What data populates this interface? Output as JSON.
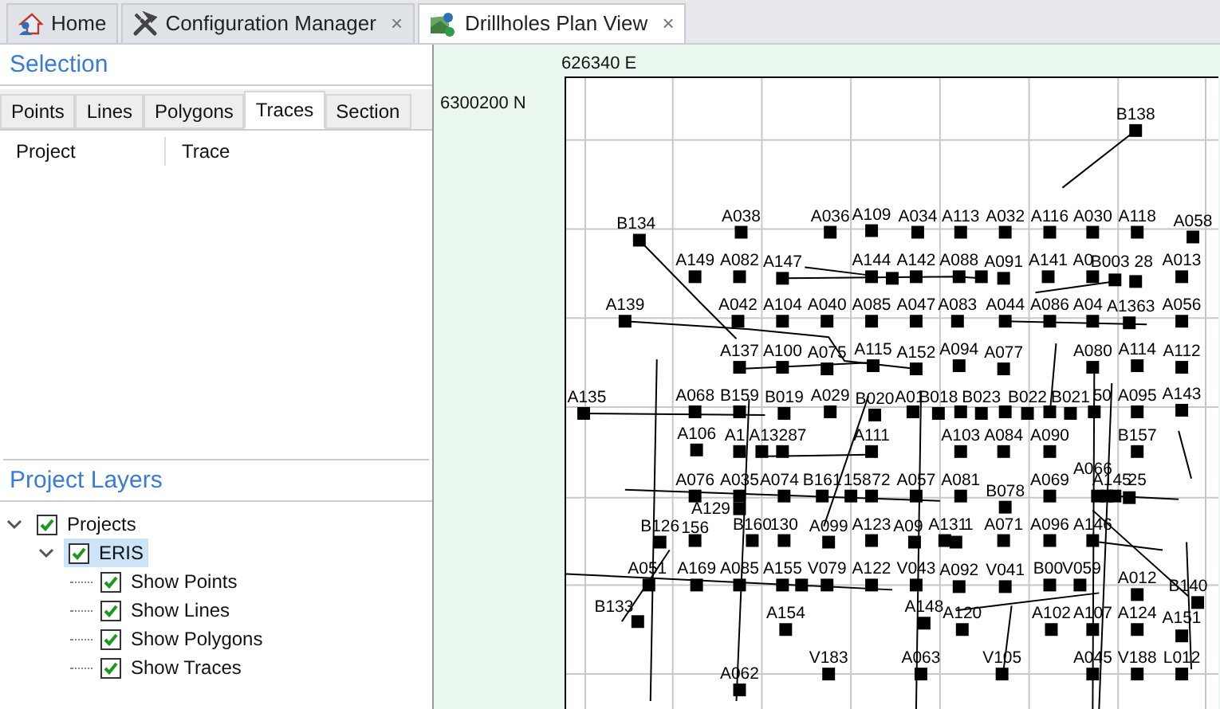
{
  "tabs": [
    {
      "label": "Home",
      "selected": false
    },
    {
      "label": "Configuration Manager",
      "selected": false,
      "close": "×"
    },
    {
      "label": "Drillholes Plan View",
      "selected": true,
      "close": "×"
    }
  ],
  "selection": {
    "title": "Selection",
    "tabs": [
      {
        "label": "Points",
        "selected": false
      },
      {
        "label": "Lines",
        "selected": false
      },
      {
        "label": "Polygons",
        "selected": false
      },
      {
        "label": "Traces",
        "selected": true
      },
      {
        "label": "Section",
        "selected": false
      }
    ],
    "columns": [
      "Project",
      "Trace"
    ]
  },
  "project_layers": {
    "title": "Project Layers",
    "tree": [
      {
        "label": "Projects",
        "checked": true,
        "expanded": true,
        "selected": false,
        "children": [
          {
            "label": "ERIS",
            "checked": true,
            "expanded": true,
            "selected": true,
            "children": [
              {
                "label": "Show Points",
                "checked": true,
                "selected": false
              },
              {
                "label": "Show Lines",
                "checked": true,
                "selected": false
              },
              {
                "label": "Show Polygons",
                "checked": true,
                "selected": false
              },
              {
                "label": "Show Traces",
                "checked": true,
                "selected": false
              }
            ]
          }
        ]
      }
    ]
  },
  "map": {
    "easting": "626340 E",
    "northing": "6300200 N",
    "points": [
      {
        "label": "B138"
      },
      {
        "label": "B134"
      },
      {
        "label": "A038"
      },
      {
        "label": "A036"
      },
      {
        "label": "A109"
      },
      {
        "label": "A034"
      },
      {
        "label": "A113"
      },
      {
        "label": "A032"
      },
      {
        "label": "A116"
      },
      {
        "label": "A030"
      },
      {
        "label": "A118"
      },
      {
        "label": "A058"
      },
      {
        "label": "A149"
      },
      {
        "label": "A082"
      },
      {
        "label": "A147"
      },
      {
        "label": "A144"
      },
      {
        "label": "A142"
      },
      {
        "label": "A088"
      },
      {
        "label": "A091"
      },
      {
        "label": "A141"
      },
      {
        "label": "A0"
      },
      {
        "label": "B003"
      },
      {
        "label": "28"
      },
      {
        "label": "A013"
      },
      {
        "label": "A139"
      },
      {
        "label": "A042"
      },
      {
        "label": "A104"
      },
      {
        "label": "A040"
      },
      {
        "label": "A085"
      },
      {
        "label": "A047"
      },
      {
        "label": "A083"
      },
      {
        "label": "A044"
      },
      {
        "label": "A086"
      },
      {
        "label": "A04"
      },
      {
        "label": "A1363"
      },
      {
        "label": "A056"
      },
      {
        "label": "A137"
      },
      {
        "label": "A100"
      },
      {
        "label": "A075"
      },
      {
        "label": "A115"
      },
      {
        "label": "A152"
      },
      {
        "label": "A094"
      },
      {
        "label": "A077"
      },
      {
        "label": "A080"
      },
      {
        "label": "A114"
      },
      {
        "label": "A112"
      },
      {
        "label": "A135"
      },
      {
        "label": "A068"
      },
      {
        "label": "B159"
      },
      {
        "label": "B019"
      },
      {
        "label": "A029"
      },
      {
        "label": "B020"
      },
      {
        "label": "A01"
      },
      {
        "label": "B018"
      },
      {
        "label": "B023"
      },
      {
        "label": "B022"
      },
      {
        "label": "B021"
      },
      {
        "label": "50"
      },
      {
        "label": "A095"
      },
      {
        "label": "A143"
      },
      {
        "label": "A106"
      },
      {
        "label": "A1"
      },
      {
        "label": "A13287"
      },
      {
        "label": "A111"
      },
      {
        "label": "A103"
      },
      {
        "label": "A084"
      },
      {
        "label": "A090"
      },
      {
        "label": "B157"
      },
      {
        "label": "A076"
      },
      {
        "label": "A035"
      },
      {
        "label": "A074"
      },
      {
        "label": "B161"
      },
      {
        "label": "158"
      },
      {
        "label": "72"
      },
      {
        "label": "A057"
      },
      {
        "label": "A081"
      },
      {
        "label": "B078"
      },
      {
        "label": "A069"
      },
      {
        "label": "A066"
      },
      {
        "label": "A145"
      },
      {
        "label": "25"
      },
      {
        "label": "A129"
      },
      {
        "label": "B126"
      },
      {
        "label": "156"
      },
      {
        "label": "B160"
      },
      {
        "label": "130"
      },
      {
        "label": "A099"
      },
      {
        "label": "A123"
      },
      {
        "label": "A09"
      },
      {
        "label": "A131"
      },
      {
        "label": "1"
      },
      {
        "label": "A071"
      },
      {
        "label": "A096"
      },
      {
        "label": "A146"
      },
      {
        "label": "A051"
      },
      {
        "label": "A169"
      },
      {
        "label": "A085"
      },
      {
        "label": "A155"
      },
      {
        "label": "V079"
      },
      {
        "label": "A122"
      },
      {
        "label": "V043"
      },
      {
        "label": "A092"
      },
      {
        "label": "V041"
      },
      {
        "label": "B00"
      },
      {
        "label": "V059"
      },
      {
        "label": "A012"
      },
      {
        "label": "B133"
      },
      {
        "label": "B140"
      },
      {
        "label": "A154"
      },
      {
        "label": "A148"
      },
      {
        "label": "A120"
      },
      {
        "label": "A102"
      },
      {
        "label": "A107"
      },
      {
        "label": "A124"
      },
      {
        "label": "A151"
      },
      {
        "label": "V183"
      },
      {
        "label": "A063"
      },
      {
        "label": "V105"
      },
      {
        "label": "A045"
      },
      {
        "label": "V188"
      },
      {
        "label": "L012"
      },
      {
        "label": "A062"
      }
    ]
  }
}
